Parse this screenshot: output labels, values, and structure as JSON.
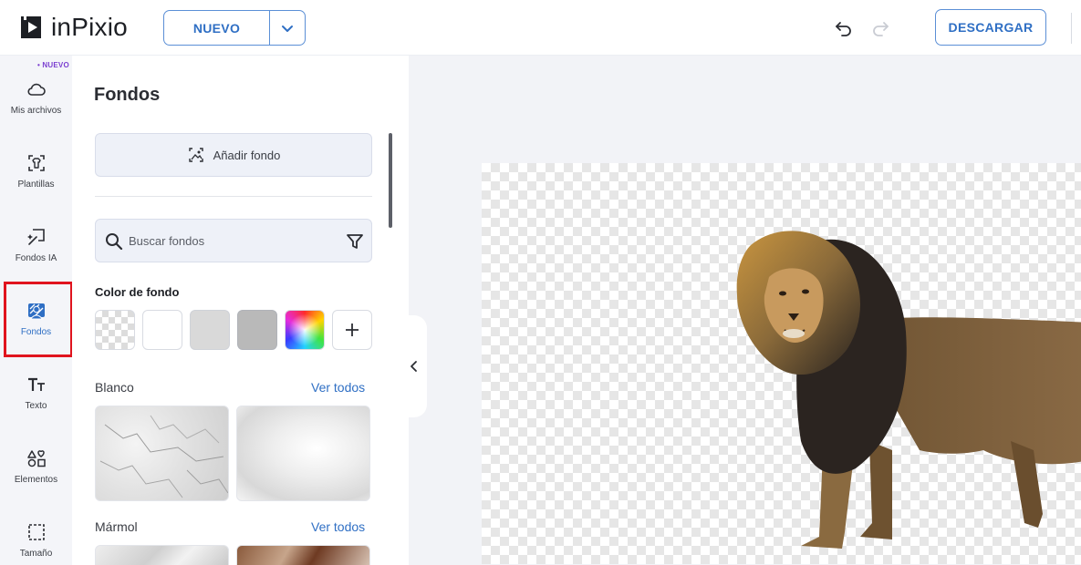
{
  "app": {
    "logo_text": "inPixio"
  },
  "toolbar": {
    "new_label": "NUEVO",
    "download_label": "DESCARGAR"
  },
  "rail": {
    "badge": "• NUEVO",
    "items": [
      {
        "label": "Mis archivos",
        "icon": "cloud-icon"
      },
      {
        "label": "Plantillas",
        "icon": "template-icon"
      },
      {
        "label": "Fondos IA",
        "icon": "ai-background-icon"
      },
      {
        "label": "Fondos",
        "icon": "background-icon",
        "active": true
      },
      {
        "label": "Texto",
        "icon": "text-icon"
      },
      {
        "label": "Elementos",
        "icon": "shapes-icon"
      },
      {
        "label": "Tamaño",
        "icon": "resize-icon"
      }
    ]
  },
  "panel": {
    "title": "Fondos",
    "add_background": "Añadir fondo",
    "search_placeholder": "Buscar fondos",
    "color_heading": "Color de fondo",
    "swatches": [
      "transparent",
      "#ffffff",
      "#d9d9d9",
      "#b9b9b9",
      "rainbow",
      "add"
    ],
    "categories": [
      {
        "name": "Blanco",
        "link": "Ver todos"
      },
      {
        "name": "Mármol",
        "link": "Ver todos"
      }
    ]
  },
  "colors": {
    "accent": "#2f6fc4",
    "badge": "#7b3fd0",
    "highlight": "#e0141e"
  }
}
